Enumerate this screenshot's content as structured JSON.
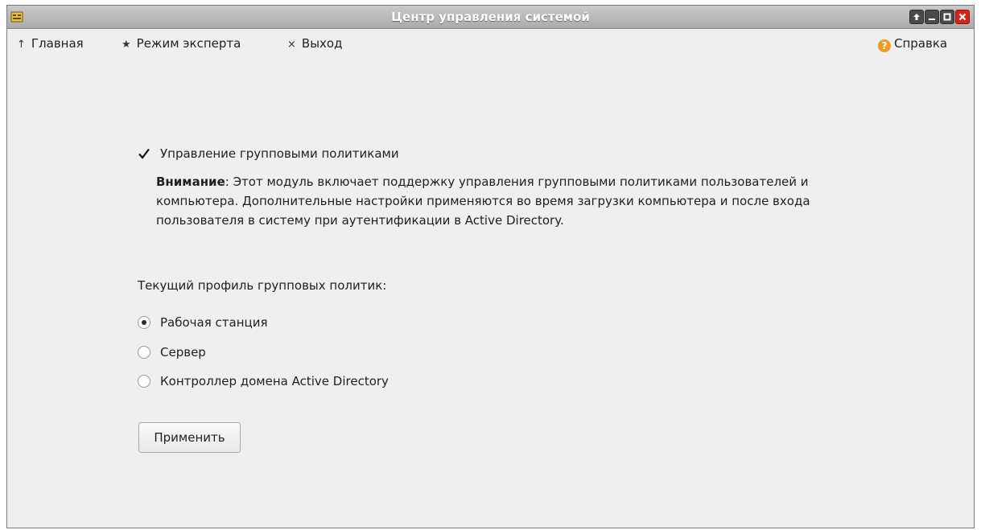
{
  "window": {
    "title": "Центр управления системой",
    "icon": "app-module-icon"
  },
  "title_buttons": [
    "up-arrow-icon",
    "minimize-icon",
    "maximize-icon",
    "close-icon"
  ],
  "toolbar": {
    "home_label": "Главная",
    "expert_label": "Режим эксперта",
    "exit_label": "Выход",
    "help_label": "Справка",
    "home_glyph": "↑",
    "expert_glyph": "★",
    "exit_glyph": "×",
    "help_glyph": "?"
  },
  "module": {
    "checkbox_label": "Управление групповыми политиками",
    "checkbox_checked": true,
    "notice_bold": "Внимание",
    "notice_text": ": Этот модуль включает поддержку управления групповыми политиками пользователей и компьютера. Дополнительные настройки применяются во время загрузки компьютера и после входа пользователя в систему при аутентификации в Active Directory.",
    "profile_label": "Текущий профиль групповых политик:",
    "profiles": [
      {
        "label": "Рабочая станция",
        "selected": true
      },
      {
        "label": "Сервер",
        "selected": false
      },
      {
        "label": "Контроллер домена Active Directory",
        "selected": false
      }
    ],
    "apply_label": "Применить"
  },
  "colors": {
    "close_button": "#d8231b",
    "help_icon": "#f29b1d",
    "window_bg": "#efefef"
  }
}
